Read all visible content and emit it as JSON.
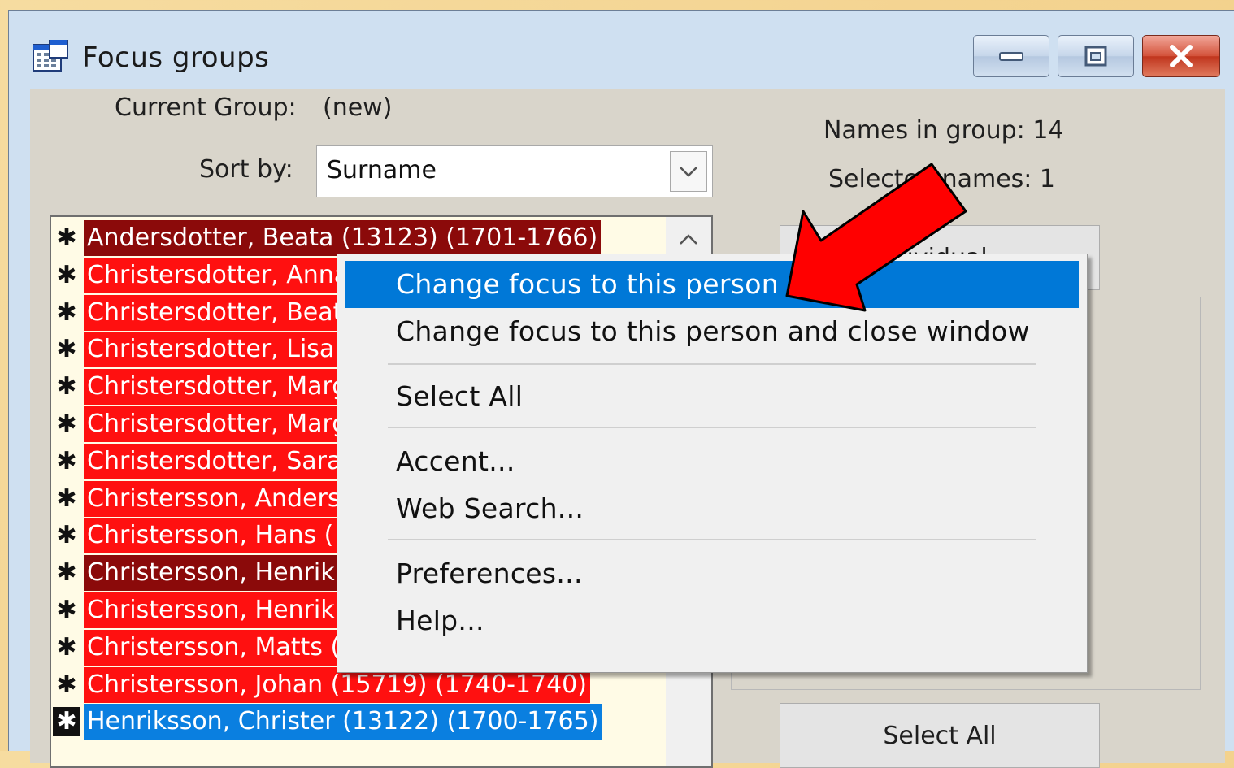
{
  "window": {
    "title": "Focus groups",
    "icons": {
      "app": "grid-window-icon",
      "minimize": "minimize-icon",
      "maximize": "maximize-icon",
      "close": "close-icon"
    }
  },
  "form": {
    "current_group_label": "Current Group:",
    "current_group_value": "(new)",
    "sort_label": "Sort by:",
    "sort_value": "Surname",
    "names_in_group": "Names in group: 14",
    "selected_names": "Selected names: 1"
  },
  "list": {
    "mark_symbol": "✱",
    "rows": [
      {
        "name": "Andersdotter, Beata (13123) (1701-1766)",
        "color": "#8b0a0a"
      },
      {
        "name": "Christersdotter, Anna",
        "color": "#ff1010"
      },
      {
        "name": "Christersdotter, Beata",
        "color": "#ff1010"
      },
      {
        "name": "Christersdotter, Lisa",
        "color": "#ff1010"
      },
      {
        "name": "Christersdotter, Margareta",
        "color": "#ff1010"
      },
      {
        "name": "Christersdotter, Margareta",
        "color": "#ff1010"
      },
      {
        "name": "Christersdotter, Sara",
        "color": "#ff1010"
      },
      {
        "name": "Christersson, Anders",
        "color": "#ff1010"
      },
      {
        "name": "Christersson, Hans (",
        "color": "#ff1010"
      },
      {
        "name": "Christersson, Henrik",
        "color": "#8b0a0a"
      },
      {
        "name": "Christersson, Henrik",
        "color": "#ff1010"
      },
      {
        "name": "Christersson, Matts (",
        "color": "#ff1010"
      },
      {
        "name": "Christersson, Johan (15719) (1740-1740)",
        "color": "#ff1010"
      },
      {
        "name": "Henriksson, Christer (13122) (1700-1765)",
        "color": "#0a7fe0"
      }
    ]
  },
  "right_panel": {
    "individual_button": "Individual...",
    "select_all_button": "Select All"
  },
  "context_menu": {
    "items": [
      "Change focus to this person",
      "Change focus to this person and close window",
      "Select All",
      "Accent...",
      "Web Search...",
      "Preferences...",
      "Help..."
    ],
    "highlight_color": "#0078d7"
  },
  "annotation": {
    "arrow_color": "#ff0000"
  }
}
